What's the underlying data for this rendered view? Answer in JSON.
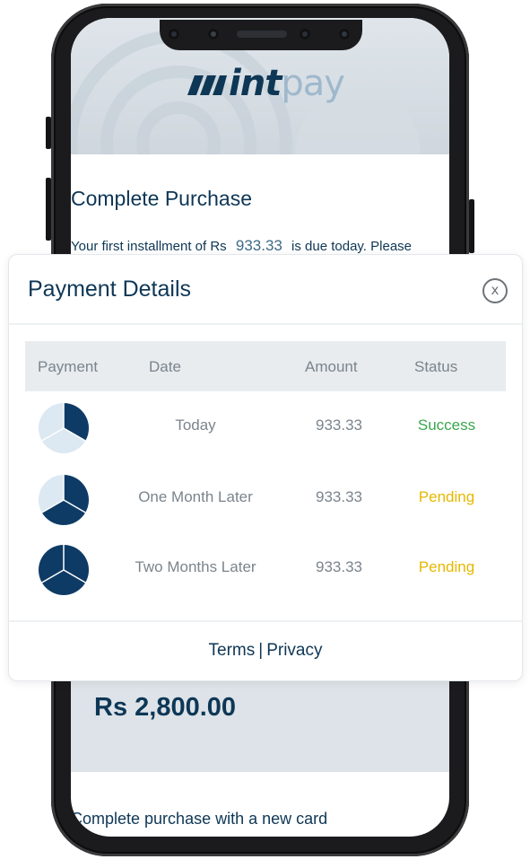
{
  "brand": {
    "logo_int": "int",
    "logo_pay": "pay"
  },
  "checkout": {
    "title": "Complete Purchase",
    "installment_prefix": "Your first installment of Rs",
    "installment_amount": "933.33",
    "installment_suffix": "is due today. Please",
    "total": "Rs 2,800.00",
    "new_card_label": "Complete purchase with a new card"
  },
  "modal": {
    "title": "Payment Details",
    "close_label": "x",
    "columns": [
      "Payment",
      "Date",
      "Amount",
      "Status"
    ],
    "rows": [
      {
        "date": "Today",
        "amount": "933.33",
        "status": "Success",
        "paid_fraction": "1/3"
      },
      {
        "date": "One Month Later",
        "amount": "933.33",
        "status": "Pending",
        "paid_fraction": "2/3"
      },
      {
        "date": "Two Months Later",
        "amount": "933.33",
        "status": "Pending",
        "paid_fraction": "3/3"
      }
    ],
    "footer": {
      "terms": "Terms",
      "separator": "|",
      "privacy": "Privacy"
    }
  },
  "colors": {
    "brand_navy": "#0e3756",
    "success": "#3aa64f",
    "pending": "#e6b800",
    "pie_light": "#dce8f2"
  }
}
